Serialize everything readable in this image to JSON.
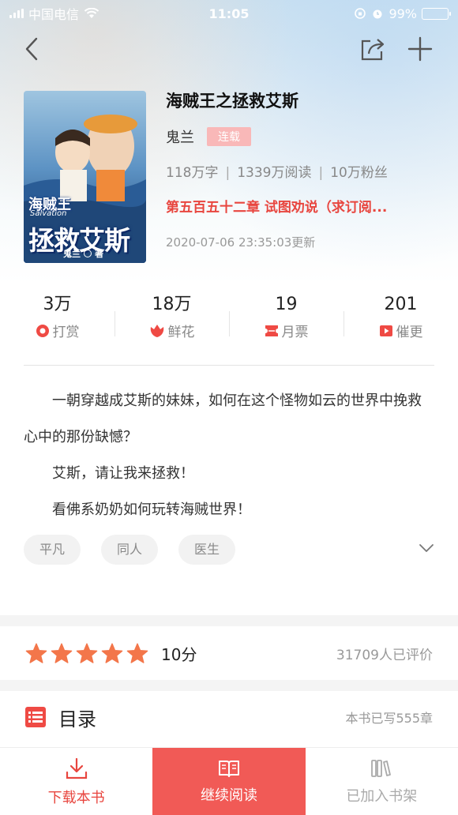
{
  "status_bar": {
    "carrier": "中国电信",
    "time": "11:05",
    "battery": "99%",
    "battery_level": 0.99
  },
  "nav": {
    "back_icon": "chevron-left-icon",
    "share_icon": "share-icon",
    "add_icon": "plus-icon"
  },
  "book": {
    "cover_title": "拯救艾斯",
    "cover_title_small": "海贼王",
    "cover_subtitle": "Salvation",
    "cover_author": "鬼兰",
    "cover_author_suffix": "著",
    "title": "海贼王之拯救艾斯",
    "author": "鬼兰",
    "status": "连载",
    "word_count": "118万字",
    "reads": "1339万阅读",
    "fans": "10万粉丝",
    "latest_chapter": "第五百五十二章 试图劝说（求订阅...",
    "update_time": "2020-07-06 23:35:03更新"
  },
  "metrics": [
    {
      "value": "3万",
      "label": "打赏",
      "icon": "reward-icon"
    },
    {
      "value": "18万",
      "label": "鲜花",
      "icon": "flower-icon"
    },
    {
      "value": "19",
      "label": "月票",
      "icon": "ticket-icon"
    },
    {
      "value": "201",
      "label": "催更",
      "icon": "urge-icon"
    }
  ],
  "description": [
    "一朝穿越成艾斯的妹妹，如何在这个怪物如云的世界中挽救心中的那份缺憾？",
    "艾斯，请让我来拯救！",
    "看佛系奶奶如何玩转海贼世界！"
  ],
  "tags": [
    "平凡",
    "同人",
    "医生"
  ],
  "rating": {
    "stars": 5,
    "score": "10分",
    "count": "31709人已评价"
  },
  "catalog": {
    "title": "目录",
    "chapter_count": "本书已写555章"
  },
  "bottom_bar": {
    "download": "下载本书",
    "continue": "继续阅读",
    "shelf": "已加入书架"
  },
  "colors": {
    "accent": "#f15a56",
    "accent_text": "#e8463f",
    "star": "#f3764a"
  }
}
